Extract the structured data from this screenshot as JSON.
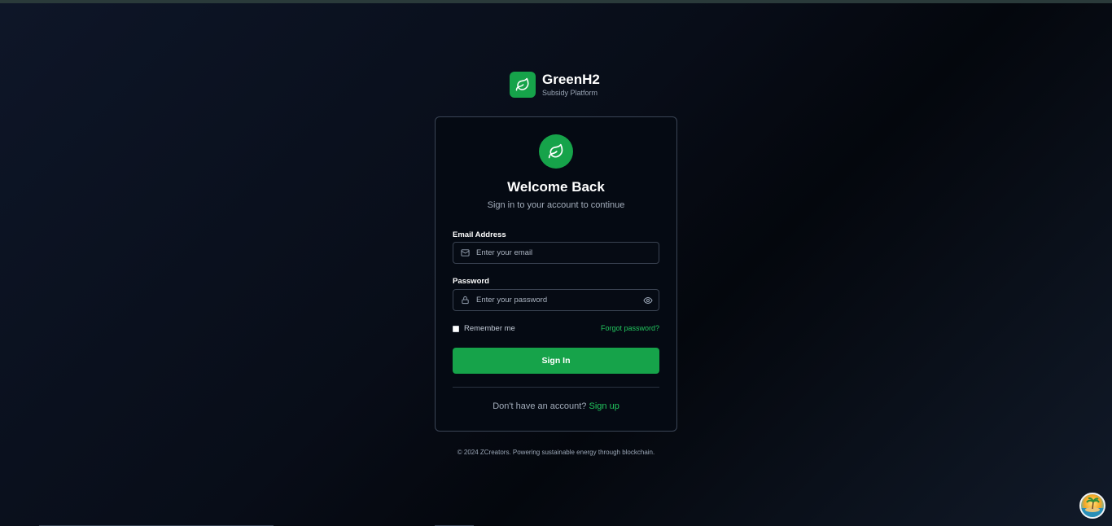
{
  "brand": {
    "name": "GreenH2",
    "tagline": "Subsidy Platform",
    "logo_icon": "leaf-icon",
    "accent": "#16a34a"
  },
  "card": {
    "icon": "leaf-icon",
    "title": "Welcome Back",
    "subtitle": "Sign in to your account to continue",
    "email": {
      "label": "Email Address",
      "placeholder": "Enter your email",
      "icon": "mail-icon",
      "value": ""
    },
    "password": {
      "label": "Password",
      "placeholder": "Enter your password",
      "icon": "lock-icon",
      "toggle_icon": "eye-icon",
      "value": ""
    },
    "remember_label": "Remember me",
    "remember_checked": false,
    "forgot_link": "Forgot password?",
    "submit_label": "Sign In",
    "signup_prompt": "Don't have an account?",
    "signup_link": "Sign up"
  },
  "footer": {
    "text": "© 2024 ZCreators. Powering sustainable energy through blockchain."
  },
  "colors": {
    "link": "#22c55e",
    "button": "#16a34a",
    "card_border": "#3b4556"
  }
}
